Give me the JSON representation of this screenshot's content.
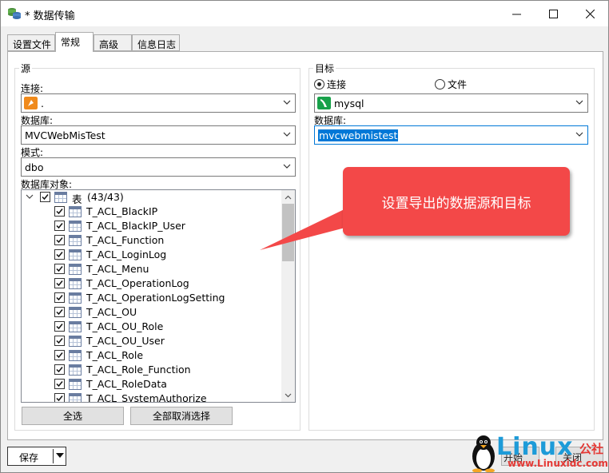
{
  "window": {
    "title": "* 数据传输",
    "minimize_symbol": "—",
    "maximize_symbol": "☐",
    "close_symbol": "✕"
  },
  "tabs": [
    {
      "label": "设置文件",
      "active": false
    },
    {
      "label": "常规",
      "active": true
    },
    {
      "label": "高级",
      "active": false
    },
    {
      "label": "信息日志",
      "active": false
    }
  ],
  "source": {
    "group_title": "源",
    "connection_label": "连接:",
    "connection_value": ".",
    "database_label": "数据库:",
    "database_value": "MVCWebMisTest",
    "schema_label": "模式:",
    "schema_value": "dbo",
    "objects_label": "数据库对象:",
    "tree_root": {
      "label": "表",
      "count": "(43/43)"
    },
    "tables": [
      "T_ACL_BlackIP",
      "T_ACL_BlackIP_User",
      "T_ACL_Function",
      "T_ACL_LoginLog",
      "T_ACL_Menu",
      "T_ACL_OperationLog",
      "T_ACL_OperationLogSetting",
      "T_ACL_OU",
      "T_ACL_OU_Role",
      "T_ACL_OU_User",
      "T_ACL_Role",
      "T_ACL_Role_Function",
      "T_ACL_RoleData",
      "T_ACL_SystemAuthorize"
    ],
    "select_all_label": "全选",
    "deselect_all_label": "全部取消选择"
  },
  "target": {
    "group_title": "目标",
    "radio_connection_label": "连接",
    "radio_file_label": "文件",
    "selected_mode": "connection",
    "connection_value": "mysql",
    "database_label": "数据库:",
    "database_value": "mvcwebmistest"
  },
  "callout_text": "设置导出的数据源和目标",
  "footer": {
    "save_label": "保存",
    "start_label_partial": "开始",
    "close_label_partial": "关闭"
  },
  "watermark": {
    "brand": "Linux",
    "brand_cn": "公社",
    "url": "www.Linuxidc.com"
  },
  "colors": {
    "accent": "#0078d7",
    "callout": "#f34848",
    "watermark_blue": "#1d9bd8",
    "watermark_red": "#e53935",
    "mysql_green": "#18a14a",
    "source_conn_orange": "#f08a1c"
  }
}
